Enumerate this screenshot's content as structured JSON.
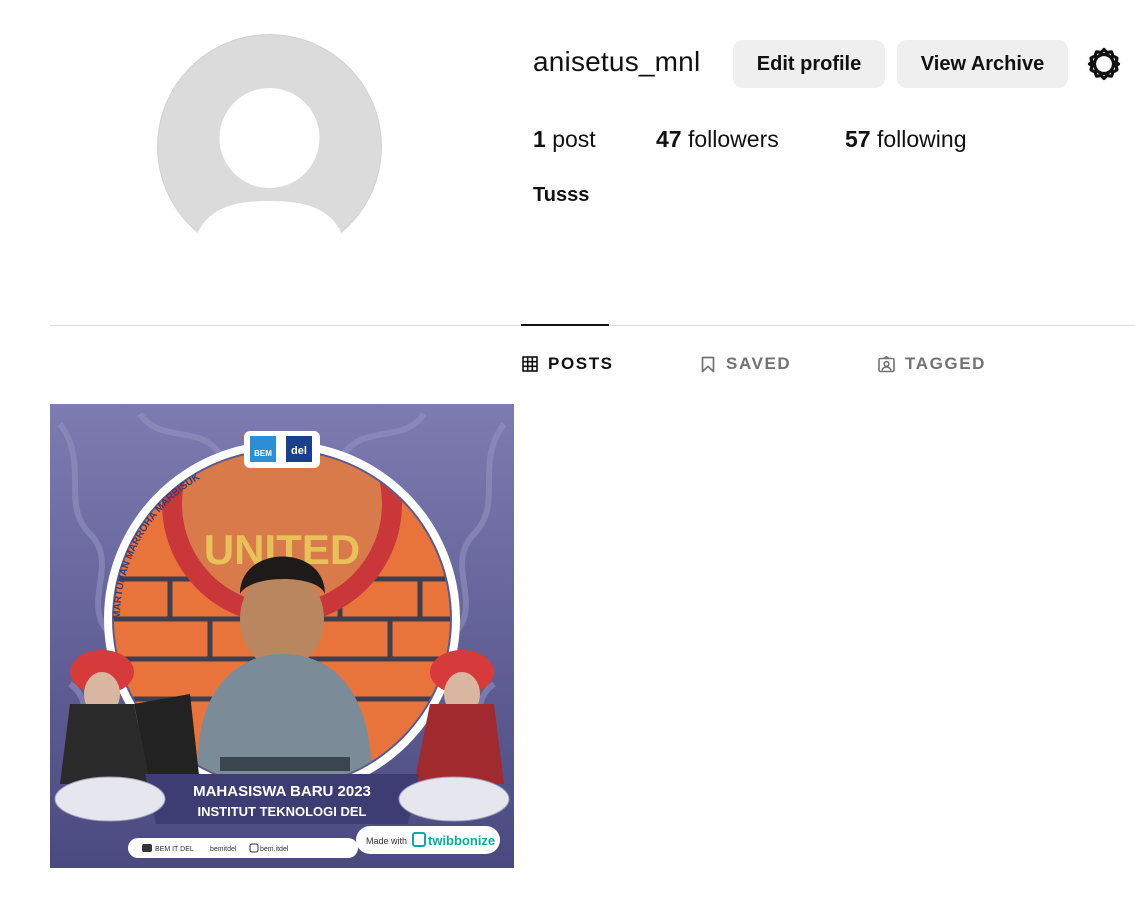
{
  "profile": {
    "username": "anisetus_mnl",
    "bio": "Tusss",
    "avatar_icon": "default-avatar-icon"
  },
  "actions": {
    "edit_profile_label": "Edit profile",
    "view_archive_label": "View Archive",
    "settings_icon": "gear-icon"
  },
  "stats": {
    "posts_count": "1",
    "posts_label": "post",
    "followers_count": "47",
    "followers_label": "followers",
    "following_count": "57",
    "following_label": "following"
  },
  "tabs": [
    {
      "label": "POSTS",
      "icon": "grid-icon",
      "active": true
    },
    {
      "label": "SAVED",
      "icon": "bookmark-icon",
      "active": false
    },
    {
      "label": "TAGGED",
      "icon": "tagged-icon",
      "active": false
    }
  ],
  "post": {
    "title_line1": "MAHASISWA BARU 2023",
    "title_line2": "INSTITUT TEKNOLOGI DEL",
    "arc_text": "MARTUHAN MARROHA MARBISUK",
    "logo_left": "BEM",
    "logo_right": "del",
    "wall_text": "UNITED",
    "socials": [
      "BEM IT DEL",
      "bemitdel",
      "bem.itdel"
    ],
    "made_with": "Made with",
    "brand": "twibbonize"
  },
  "colors": {
    "button_bg": "#efefef",
    "divider": "#dbdbdb",
    "inactive_tab": "#737373",
    "frame_purple": "#5b5a8e"
  }
}
